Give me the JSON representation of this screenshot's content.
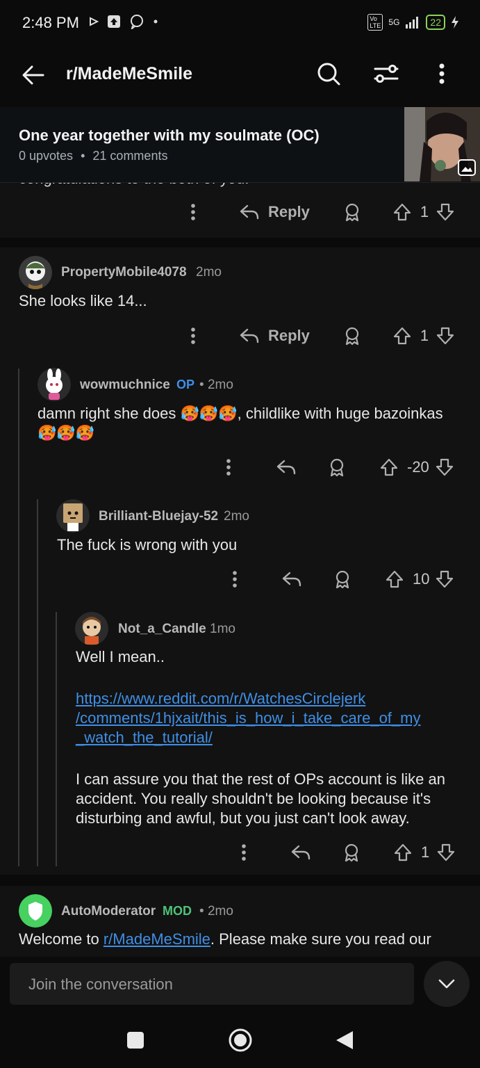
{
  "status_bar": {
    "time": "2:48 PM",
    "network": "5G",
    "volte": "Vo LTE",
    "battery": "22"
  },
  "header": {
    "title": "r/MadeMeSmile"
  },
  "post": {
    "title": "One year together with my soulmate (OC)",
    "upvotes": "0 upvotes",
    "dot": "•",
    "comments": "21 comments"
  },
  "prev_comment": {
    "cut_text": "congratulations to the both of you.",
    "reply_label": "Reply",
    "score": "1"
  },
  "comments": [
    {
      "user": "PropertyMobile4078",
      "age": "2mo",
      "text": "She looks like 14...",
      "reply_label": "Reply",
      "score": "1"
    },
    {
      "user": "wowmuchnice",
      "flair": "OP",
      "sep": "•",
      "age": "2mo",
      "text1": "damn right she does",
      "emoji": "🥵🥵🥵",
      "text2": ", childlike with huge bazoinkas",
      "score": "-20"
    },
    {
      "user": "Brilliant-Bluejay-52",
      "age": "2mo",
      "text": "The fuck is wrong with you",
      "score": "10"
    },
    {
      "user": "Not_a_Candle",
      "age": "1mo",
      "text1": "Well I mean..",
      "link": "https://www.reddit.com/r/WatchesCirclejerk/comments/1hjxait/this_is_how_i_take_care_of_my_watch_the_tutorial/",
      "link_line1": "https://www.reddit.com/r/WatchesCirclejerk",
      "link_line2": "/comments/1hjxait/this_is_how_i_take_care_of_my",
      "link_line3": "_watch_the_tutorial/",
      "text2": "I can assure you that the rest of OPs account is like an accident. You really shouldn't be looking because it's disturbing and awful, but you just can't look away.",
      "score": "1"
    },
    {
      "user": "AutoModerator",
      "flair": "MOD",
      "sep": "•",
      "age": "2mo",
      "text_pre": "Welcome to ",
      "link": "r/MadeMeSmile",
      "text_post": ". Please make sure you read our"
    }
  ],
  "composer": {
    "placeholder": "Join the conversation"
  },
  "colors": {
    "link": "#3f8fe6",
    "mod": "#4ec27a",
    "background": "#0b0b0b",
    "card": "#121212"
  }
}
